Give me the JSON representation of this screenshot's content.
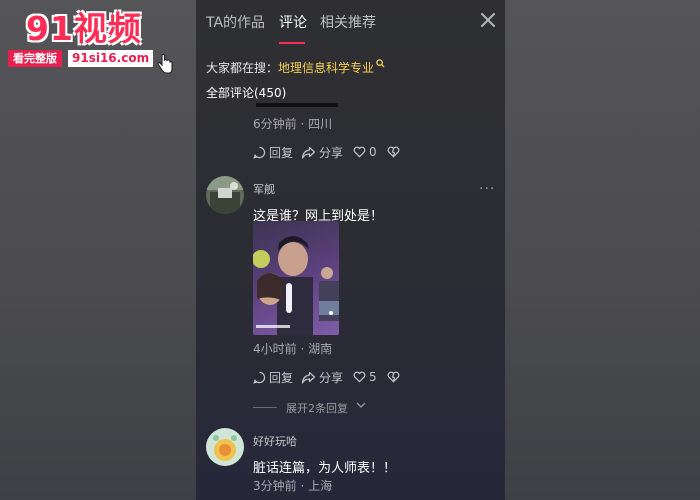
{
  "watermark": {
    "title": "91视频",
    "badge": "看完整版",
    "url": "91si16.com"
  },
  "tabs": [
    {
      "label": "TA的作品",
      "active": false
    },
    {
      "label": "评论",
      "active": true
    },
    {
      "label": "相关推荐",
      "active": false
    }
  ],
  "search_hint": {
    "prefix": "大家都在搜：",
    "term": "地理信息科学专业"
  },
  "all_comments_label": "全部评论(450)",
  "comments": [
    {
      "meta": "6分钟前 · 四川",
      "reply": "回复",
      "share": "分享",
      "likes": "0"
    },
    {
      "user": "军舰",
      "text": "这是谁？网上到处是！",
      "meta": "4小时前 · 湖南",
      "reply": "回复",
      "share": "分享",
      "likes": "5",
      "expand_label": "展开2条回复"
    },
    {
      "user": "好好玩哈",
      "text": "脏话连篇，为人师表！！",
      "meta": "3分钟前 · 上海"
    }
  ],
  "colors": {
    "accent": "#fe2c55",
    "search_term": "#f7d154",
    "panel_bg": "#2c2d33"
  }
}
